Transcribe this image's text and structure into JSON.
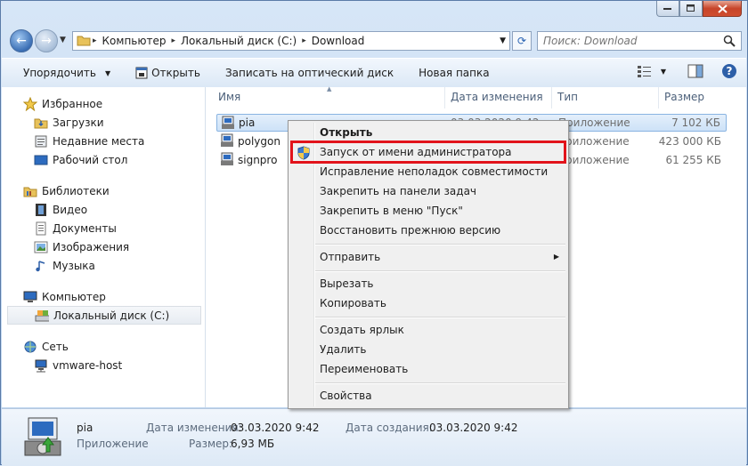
{
  "window": {
    "caption_buttons": [
      "minimize",
      "maximize",
      "close"
    ]
  },
  "address": {
    "crumbs": [
      "Компьютер",
      "Локальный диск (C:)",
      "Download"
    ],
    "search_placeholder": "Поиск: Download"
  },
  "toolbar": {
    "organize": "Упорядочить",
    "open": "Открыть",
    "burn": "Записать на оптический диск",
    "new_folder": "Новая папка"
  },
  "nav": {
    "favorites": {
      "label": "Избранное",
      "items": [
        "Загрузки",
        "Недавние места",
        "Рабочий стол"
      ]
    },
    "libraries": {
      "label": "Библиотеки",
      "items": [
        "Видео",
        "Документы",
        "Изображения",
        "Музыка"
      ]
    },
    "computer": {
      "label": "Компьютер",
      "items": [
        "Локальный диск (C:)"
      ]
    },
    "network": {
      "label": "Сеть",
      "items": [
        "vmware-host"
      ]
    }
  },
  "columns": {
    "name": "Имя",
    "date": "Дата изменения",
    "type": "Тип",
    "size": "Размер"
  },
  "files": [
    {
      "name": "pia",
      "date": "03.03.2020 9:42",
      "type": "Приложение",
      "size": "7 102 КБ"
    },
    {
      "name": "polygon",
      "date": "",
      "type": "Приложение",
      "size": "423 000 КБ"
    },
    {
      "name": "signpro",
      "date": "",
      "type": "Приложение",
      "size": "61 255 КБ"
    }
  ],
  "context_menu": {
    "open": "Открыть",
    "run_as_admin": "Запуск от имени администратора",
    "troubleshoot": "Исправление неполадок совместимости",
    "pin_taskbar": "Закрепить на панели задач",
    "pin_start": "Закрепить в меню \"Пуск\"",
    "restore": "Восстановить прежнюю версию",
    "send_to": "Отправить",
    "cut": "Вырезать",
    "copy": "Копировать",
    "create_shortcut": "Создать ярлык",
    "delete": "Удалить",
    "rename": "Переименовать",
    "properties": "Свойства"
  },
  "details": {
    "name": "pia",
    "type": "Приложение",
    "modified_label": "Дата изменения:",
    "modified_value": "03.03.2020 9:42",
    "size_label": "Размер:",
    "size_value": "6,93 МБ",
    "created_label": "Дата создания:",
    "created_value": "03.03.2020 9:42"
  },
  "colors": {
    "highlight_border": "#e2131b",
    "selection": "#cde2f7"
  }
}
